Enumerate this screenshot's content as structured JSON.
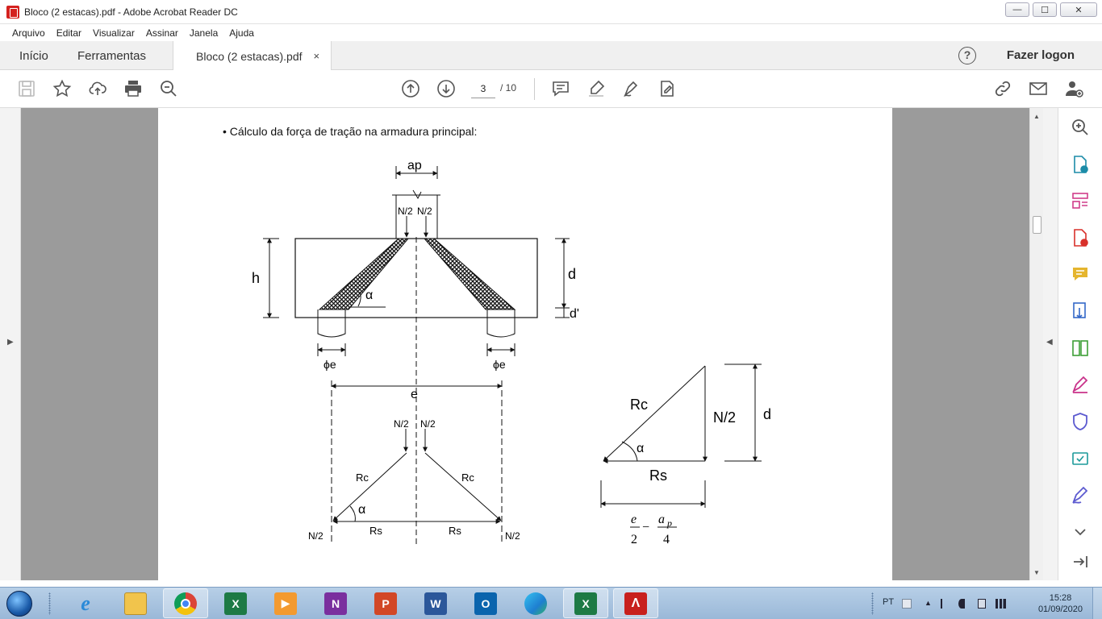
{
  "window": {
    "title": "Bloco (2 estacas).pdf - Adobe Acrobat Reader DC",
    "minimize": "—",
    "maximize": "☐",
    "close": "✕"
  },
  "menu": [
    "Arquivo",
    "Editar",
    "Visualizar",
    "Assinar",
    "Janela",
    "Ajuda"
  ],
  "tabs": {
    "home": "Início",
    "tools": "Ferramentas",
    "document": "Bloco (2 estacas).pdf",
    "close": "×",
    "help": "?",
    "logon": "Fazer logon"
  },
  "toolbar": {
    "page_current": "3",
    "page_total": "/ 10"
  },
  "document": {
    "heading": "• Cálculo da força de tração na armadura principal:",
    "top": {
      "ap": "ap",
      "n2_left": "N/2",
      "n2_right": "N/2",
      "h": "h",
      "d": "d",
      "d_prime": "d'",
      "alpha": "α",
      "phi_left": "ϕe",
      "phi_right": "ϕe"
    },
    "mid": {
      "e": "e",
      "n2_top_left": "N/2",
      "n2_top_right": "N/2",
      "rc_left": "Rc",
      "rc_right": "Rc",
      "alpha": "α",
      "rs_left": "Rs",
      "rs_right": "Rs",
      "n2_bottom_left": "N/2",
      "n2_bottom_right": "N/2"
    },
    "triangle": {
      "rc": "Rc",
      "n2": "N/2",
      "d": "d",
      "alpha": "α",
      "rs": "Rs",
      "frac_e": "e",
      "frac_2": "2",
      "minus": "−",
      "frac_ap": "a",
      "frac_ap_sub": "p",
      "frac_4": "4"
    }
  },
  "taskbar": {
    "lang": "PT",
    "time": "15:28",
    "date": "01/09/2020"
  },
  "colors": {
    "accent_red": "#d4221f",
    "taskbar": "#a8c4e0",
    "docarea": "#9b9b9b"
  }
}
